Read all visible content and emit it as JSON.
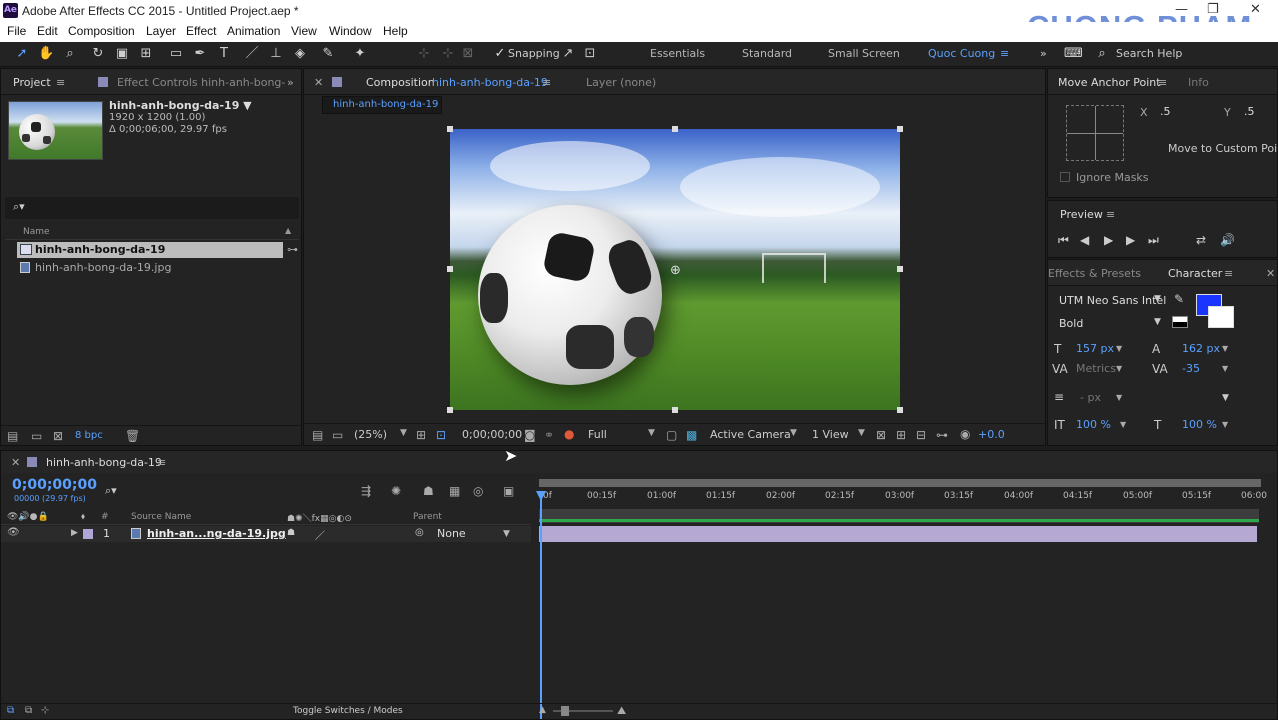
{
  "app": {
    "title": "Adobe After Effects CC 2015 - Untitled Project.aep *",
    "logo": "Ae",
    "watermark": "CUONG PHAM"
  },
  "menu": [
    "File",
    "Edit",
    "Composition",
    "Layer",
    "Effect",
    "Animation",
    "View",
    "Window",
    "Help"
  ],
  "toolbar": {
    "snapping": "Snapping",
    "workspaces": [
      "Essentials",
      "Standard",
      "Small Screen",
      "Quoc Cuong"
    ],
    "search": "Search Help"
  },
  "project": {
    "tab": "Project",
    "effect_tab": "Effect Controls hinh-anh-bong-",
    "selected_name": "hinh-anh-bong-da-19 ▼",
    "info1": "1920 x 1200 (1.00)",
    "info2": "Δ 0;00;06;00, 29.97 fps",
    "search_icon": "⌕▾",
    "col_name": "Name",
    "items": [
      "hinh-anh-bong-da-19",
      "hinh-anh-bong-da-19.jpg"
    ],
    "bpc": "8 bpc"
  },
  "composition": {
    "tab_prefix": "Composition",
    "tab_name": "hinh-anh-bong-da-19",
    "layer_tab": "Layer (none)",
    "crumb": "hinh-anh-bong-da-19",
    "zoom": "(25%)",
    "timecode": "0;00;00;00",
    "resolution": "Full",
    "camera": "Active Camera",
    "views": "1 View",
    "exposure": "+0.0"
  },
  "anchor": {
    "tab": "Move Anchor Point",
    "info_tab": "Info",
    "x_label": "X",
    "x": ".5",
    "y_label": "Y",
    "y": ".5",
    "custom": "Move to Custom Point",
    "ignore": "Ignore Masks"
  },
  "preview": {
    "tab": "Preview"
  },
  "character": {
    "effects_tab": "Effects & Presets",
    "tab": "Character",
    "font": "UTM Neo Sans Intel",
    "style": "Bold",
    "size": "157 px",
    "leading": "162 px",
    "kerning": "Metrics",
    "tracking": "-35",
    "stroke": "- px",
    "vscale": "100 %",
    "hscale": "100 %",
    "fill_color": "#1a35ff"
  },
  "timeline": {
    "tab": "hinh-anh-bong-da-19",
    "timecode": "0;00;00;00",
    "fps": "00000 (29.97 fps)",
    "col_source": "Source Name",
    "col_hash": "#",
    "col_parent": "Parent",
    "layer_num": "1",
    "layer_name": "hinh-an...ng-da-19.jpg",
    "parent": "None",
    "ruler": [
      "0f",
      "00:15f",
      "01:00f",
      "01:15f",
      "02:00f",
      "02:15f",
      "03:00f",
      "03:15f",
      "04:00f",
      "04:15f",
      "05:00f",
      "05:15f",
      "06:00"
    ],
    "toggle": "Toggle Switches / Modes"
  }
}
